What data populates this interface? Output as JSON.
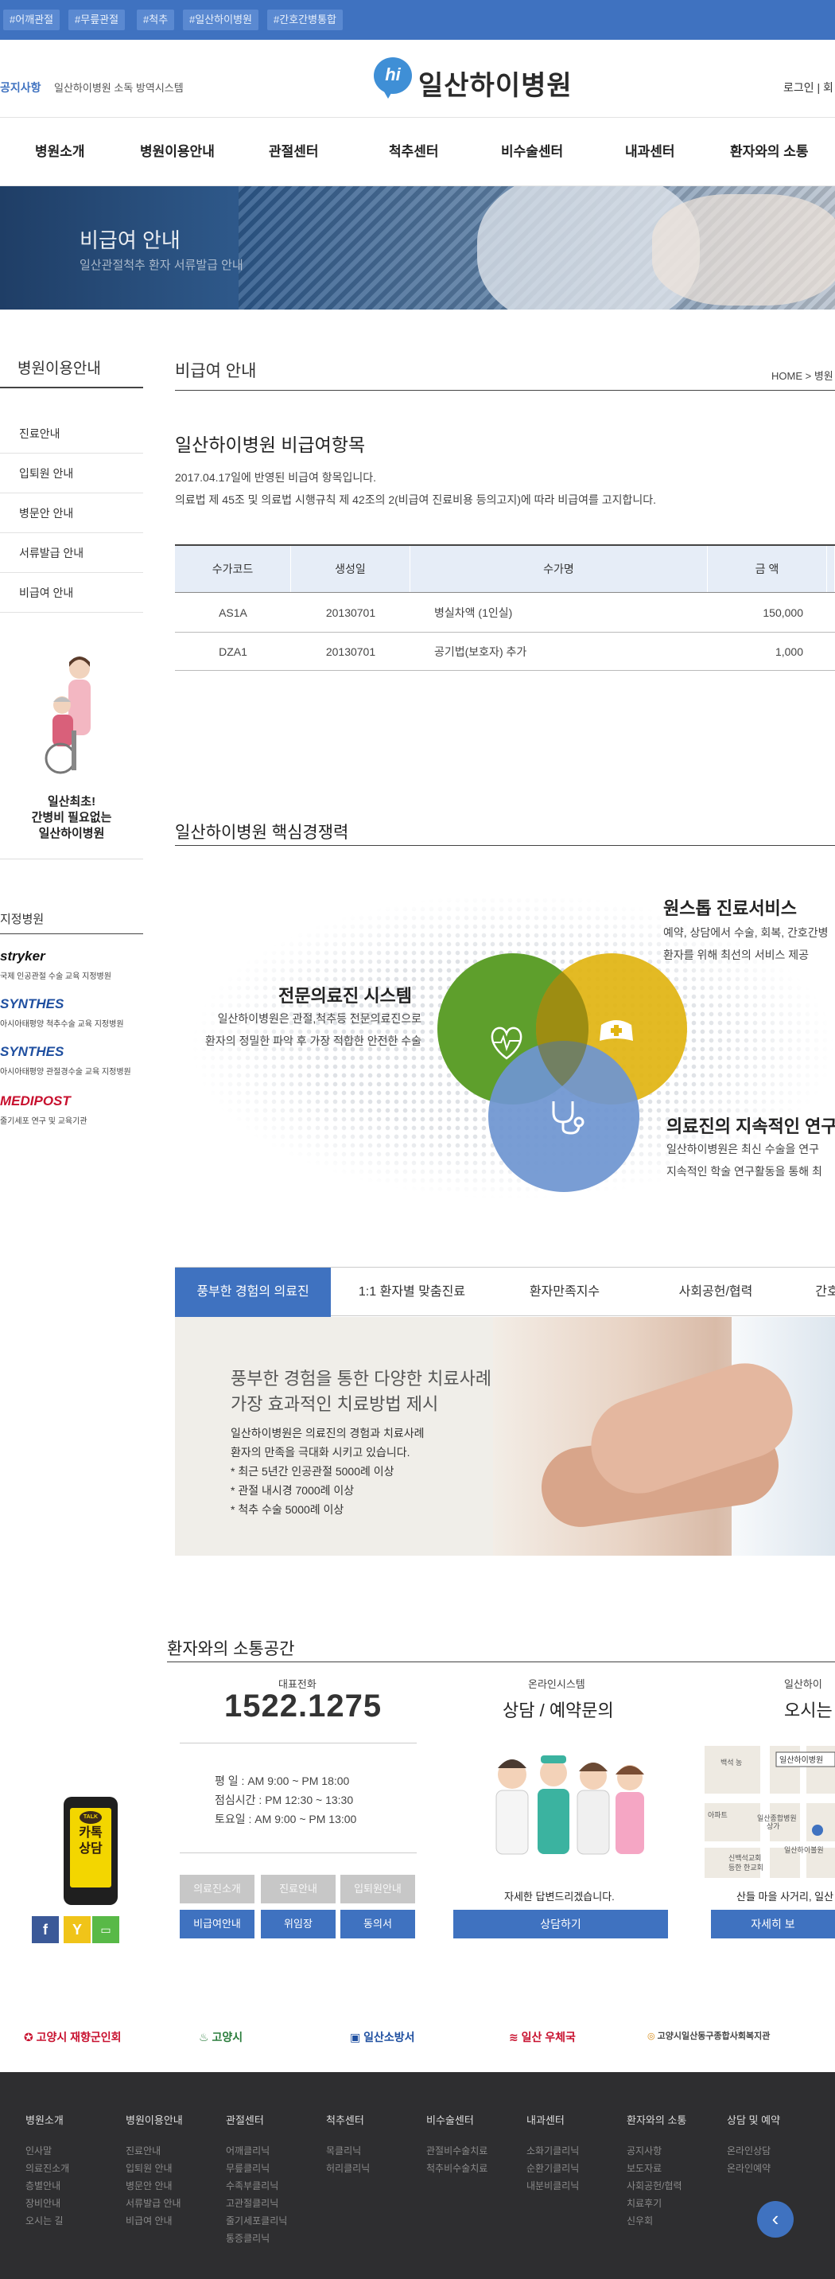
{
  "topbar": {
    "tags": [
      "#어깨관절",
      "#무릎관절",
      "#척추",
      "#일산하이병원",
      "#간호간병통합"
    ]
  },
  "header": {
    "notice_label": "공지사항",
    "notice_text": "일산하이병원 소독 방역시스템",
    "logo_mark": "hi",
    "logo_text": "일산하이병원",
    "util_text": "로그인 | 회"
  },
  "nav": {
    "items": [
      "병원소개",
      "병원이용안내",
      "관절센터",
      "척추센터",
      "비수술센터",
      "내과센터",
      "환자와의 소통"
    ]
  },
  "hero": {
    "title": "비급여 안내",
    "subtitle": "일산관절척추 환자 서류발급 안내"
  },
  "sidebar": {
    "title": "병원이용안내",
    "items": [
      "진료안내",
      "입퇴원 안내",
      "병문안 안내",
      "서류발급 안내",
      "비급여 안내"
    ],
    "ad_lines": [
      "일산최초!",
      "간병비 필요없는",
      "일산하이병원"
    ],
    "approved_title": "지정병원",
    "approved": [
      {
        "logo": "stryker",
        "sub": "국제 인공관절 수술 교육 지정병원",
        "color": "#111111"
      },
      {
        "logo": "SYNTHES",
        "sub": "아시아태평양 척추수술 교육 지정병원",
        "color": "#1f4fa0"
      },
      {
        "logo": "SYNTHES",
        "sub": "아시아태평양 관절경수술 교육 지정병원",
        "color": "#1f4fa0"
      },
      {
        "logo": "MEDIPOST",
        "sub": "줄기세포 연구 및 교육기관",
        "color": "#c8102e"
      }
    ]
  },
  "page": {
    "title": "비급여 안내",
    "breadcrumb": "HOME > 병원",
    "section_title": "일산하이병원 비급여항목",
    "intro_1": "2017.04.17일에 반영된 비급여 항목입니다.",
    "intro_2": "의료법 제 45조 및 의료법 시행규칙 제 42조의 2(비급여 진료비용 등의고지)에 따라 비급여를 고지합니다."
  },
  "fee_table": {
    "headers": [
      "수가코드",
      "생성일",
      "수가명",
      "금 액"
    ],
    "rows": [
      [
        "AS1A",
        "20130701",
        "병실차액 (1인실)",
        "150,000"
      ],
      [
        "DZA1",
        "20130701",
        "공기법(보호자) 추가",
        "1,000"
      ]
    ]
  },
  "core": {
    "title": "일산하이병원 핵심경쟁력",
    "features": [
      {
        "heading": "원스톱 진료서비스",
        "lines": [
          "예약, 상담에서 수술, 회복, 간호간병",
          "환자를 위해 최선의 서비스 제공"
        ]
      },
      {
        "heading": "전문의료진 시스템",
        "lines": [
          "일산하이병원은 관절,척추등 전문의료진으로",
          "환자의 정밀한 파악 후 가장 적합한 안전한 수술"
        ]
      },
      {
        "heading": "의료진의 지속적인 연구",
        "lines": [
          "일산하이병원은 최신 수술을 연구",
          "지속적인 학술 연구활동을 통해 최"
        ]
      }
    ],
    "icons": [
      "heart-pulse-icon",
      "nurse-cap-icon",
      "stethoscope-icon"
    ],
    "colors": {
      "green": "#5e9f2c",
      "yellow": "#e1b411",
      "blue": "#6f96d1"
    }
  },
  "tabs": {
    "items": [
      "풍부한 경험의 의료진",
      "1:1 환자별 맞춤진료",
      "환자만족지수",
      "사회공헌/협력",
      "간호"
    ],
    "active": 0,
    "panel": {
      "heading_1": "풍부한 경험을 통한 다양한 치료사례",
      "heading_2": "가장 효과적인 치료방법 제시",
      "lines": [
        "일산하이병원은 의료진의 경험과 치료사례",
        "환자의 만족을 극대화 시키고 있습니다.",
        "* 최근 5년간 인공관절 5000례 이상",
        "* 관절 내시경 7000례 이상",
        "* 척추 수술 5000례 이상"
      ]
    }
  },
  "comm": {
    "title": "환자와의 소통공간",
    "phone_label": "대표전화",
    "phone": "1522.1275",
    "hours": [
      "평 일 : AM 9:00 ~ PM 18:00",
      "점심시간 : PM 12:30 ~ 13:30",
      "토요일 : AM 9:00 ~ PM 13:00"
    ],
    "quick_gray": [
      "의료진소개",
      "진료안내",
      "입퇴원안내"
    ],
    "quick_blue": [
      "비급여안내",
      "위임장",
      "동의서"
    ],
    "online_label": "온라인시스템",
    "online_title": "상담 / 예약문의",
    "online_note": "자세한 답변드리겠습니다.",
    "online_button": "상담하기",
    "map_label": "일산하이",
    "map_title": "오시는",
    "map_note": "산들 마을 사거리, 일산 하",
    "map_button": "자세히 보",
    "map_labels": [
      "일산하이병원",
      "백석 농",
      "일산종합병원",
      "상가",
      "신백석교회",
      "등한 한교회",
      "일산하이볼원",
      "아파트"
    ],
    "kakao_text": [
      "카톡",
      "상담"
    ],
    "kakao_talk": "TALK",
    "social": [
      {
        "icon": "facebook-icon",
        "glyph": "f",
        "color": "#3b5998"
      },
      {
        "icon": "yellowid-icon",
        "glyph": "Y",
        "color": "#f0c419"
      },
      {
        "icon": "line-icon",
        "glyph": "▭",
        "color": "#58b947"
      }
    ]
  },
  "partners": [
    {
      "name": "고양시 재향군인회",
      "color": "#c8102e"
    },
    {
      "name": "고양시",
      "color": "#2a7d3c"
    },
    {
      "name": "일산소방서",
      "color": "#1f4fa0"
    },
    {
      "name": "일산 우체국",
      "color": "#c8102e"
    },
    {
      "name": "고양시일산동구종합사회복지관",
      "color": "#444444"
    }
  ],
  "footer": {
    "columns": [
      {
        "heading": "병원소개",
        "items": [
          "인사말",
          "의료진소개",
          "층별안내",
          "장비안내",
          "오시는 길"
        ]
      },
      {
        "heading": "병원이용안내",
        "items": [
          "진료안내",
          "입퇴원 안내",
          "병문안 안내",
          "서류발급 안내",
          "비급여 안내"
        ]
      },
      {
        "heading": "관절센터",
        "items": [
          "어깨클리닉",
          "무릎클리닉",
          "수족부클리닉",
          "고관절클리닉",
          "줄기세포클리닉",
          "통증클리닉"
        ]
      },
      {
        "heading": "척추센터",
        "items": [
          "목클리닉",
          "허리클리닉"
        ]
      },
      {
        "heading": "비수술센터",
        "items": [
          "관절비수술치료",
          "척추비수술치료"
        ]
      },
      {
        "heading": "내과센터",
        "items": [
          "소화기클리닉",
          "순환기클리닉",
          "내분비클리닉"
        ]
      },
      {
        "heading": "환자와의 소통",
        "items": [
          "공지사항",
          "보도자료",
          "사회공헌/협력",
          "치료후기",
          "신우회"
        ]
      },
      {
        "heading": "상담 및 예약",
        "items": [
          "온라인상담",
          "온라인예약"
        ]
      }
    ],
    "up_glyph": "‹"
  }
}
